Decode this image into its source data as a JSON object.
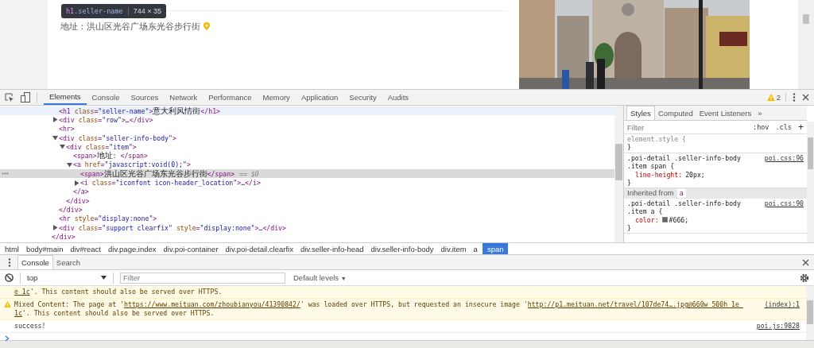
{
  "page": {
    "tooltip": {
      "tag": "h1",
      "class_name": ".seller-name",
      "size": "744 × 35"
    },
    "address": "地址：洪山区光谷广场东光谷步行街"
  },
  "devtools": {
    "tabs": [
      {
        "label": "Elements",
        "selected": true
      },
      {
        "label": "Console",
        "selected": false
      },
      {
        "label": "Sources",
        "selected": false
      },
      {
        "label": "Network",
        "selected": false
      },
      {
        "label": "Performance",
        "selected": false
      },
      {
        "label": "Memory",
        "selected": false
      },
      {
        "label": "Application",
        "selected": false
      },
      {
        "label": "Security",
        "selected": false
      },
      {
        "label": "Audits",
        "selected": false
      }
    ],
    "warning_count": "2"
  },
  "dom_tree": {
    "close": "</div>",
    "children": [
      {
        "open": "<h1 class=\"seller-name\">意大利风情街</h1>",
        "selected": false,
        "hovered": true
      },
      {
        "open": "<div class=\"row\">…</div>",
        "expanded": false,
        "selected": false,
        "hovered": false
      },
      {
        "open": "<hr>",
        "selected": false,
        "hovered": false
      },
      {
        "open": "<div class=\"seller-info-body\">",
        "expanded": true,
        "selected": false,
        "hovered": false,
        "close": "</div>",
        "children": [
          {
            "open": "<div class=\"item\">",
            "expanded": true,
            "selected": false,
            "hovered": false,
            "close": "</div>",
            "children": [
              {
                "open": "<span>地址: </span>",
                "selected": false,
                "hovered": false
              },
              {
                "open": "<a href=\"javascript:void(0);\">",
                "expanded": true,
                "selected": false,
                "hovered": false,
                "close": "</a>",
                "children": [
                  {
                    "open": "<span>洪山区光谷广场东光谷步行街</span>",
                    "suffix": "== $0",
                    "selected": true,
                    "hovered": false
                  },
                  {
                    "open": "<i class=\"iconfont icon-header_location\">…</i>",
                    "expanded": false,
                    "selected": false,
                    "hovered": false
                  }
                ]
              }
            ]
          }
        ]
      },
      {
        "open": "<hr style=\"display:none\">",
        "selected": false,
        "hovered": false
      },
      {
        "open": "<div class=\"support clearfix\" style=\"display:none\">…</div>",
        "expanded": false,
        "selected": false,
        "hovered": false
      }
    ]
  },
  "breadcrumbs": [
    {
      "label": "html",
      "selected": false
    },
    {
      "label": "body#main",
      "selected": false
    },
    {
      "label": "div#react",
      "selected": false
    },
    {
      "label": "div.page.index",
      "selected": false
    },
    {
      "label": "div.poi-container",
      "selected": false
    },
    {
      "label": "div.poi-detail.clearfix",
      "selected": false
    },
    {
      "label": "div.seller-info-head",
      "selected": false
    },
    {
      "label": "div.seller-info-body",
      "selected": false
    },
    {
      "label": "div.item",
      "selected": false
    },
    {
      "label": "a",
      "selected": false
    },
    {
      "label": "span",
      "selected": true
    }
  ],
  "styles": {
    "tabs": [
      {
        "label": "Styles",
        "selected": true
      },
      {
        "label": "Computed",
        "selected": false
      },
      {
        "label": "Event Listeners",
        "selected": false
      },
      {
        "label": "»",
        "selected": false
      }
    ],
    "filter_placeholder": "Filter",
    "hov": ":hov",
    "cls": ".cls",
    "add": "+",
    "rules": [
      {
        "kind": "rule",
        "muted": true,
        "selector": "element.style {",
        "close": "}"
      },
      {
        "kind": "rule",
        "muted": false,
        "selector": ".poi-detail .seller-info-body .item span {",
        "source": "poi.css:96",
        "declarations": [
          {
            "property": "line-height:",
            "value": "20px;"
          }
        ],
        "close": "}"
      },
      {
        "kind": "inherited",
        "label": "Inherited from",
        "element": "a"
      },
      {
        "kind": "rule",
        "muted": false,
        "selector": ".poi-detail .seller-info-body .item a {",
        "source": "poi.css:90",
        "declarations": [
          {
            "property": "color:",
            "swatch": true,
            "value": "#666;"
          }
        ],
        "close": "}"
      }
    ]
  },
  "console": {
    "tabs": [
      {
        "label": "Console",
        "selected": true
      },
      {
        "label": "Search",
        "selected": false
      }
    ],
    "context": "top",
    "filter_placeholder": "Filter",
    "levels": "Default levels",
    "levels_caret": "▼",
    "messages": [
      {
        "kind": "warning",
        "icon": false,
        "lines": [
          [
            {
              "text": "e_1c",
              "link": true
            },
            {
              "text": "'. This content should also be served over HTTPS.",
              "link": false
            }
          ]
        ]
      },
      {
        "kind": "warning",
        "icon": true,
        "source": "(index):1",
        "lines": [
          [
            {
              "text": "Mixed Content: The page at '",
              "link": false
            },
            {
              "text": "https://www.meituan.com/zhoubianyou/41390842/",
              "link": true
            },
            {
              "text": "' was loaded over HTTPS, but requested an insecure image '",
              "link": false
            },
            {
              "text": "http://p1.meituan.net/travel/107de74….jpg@660w_500h_1e_",
              "link": true
            }
          ],
          [
            {
              "text": "1c",
              "link": true
            },
            {
              "text": "'. This content should also be served over HTTPS.",
              "link": false
            }
          ]
        ]
      },
      {
        "kind": "log",
        "icon": false,
        "source": "poi.js:9828",
        "lines": [
          [
            {
              "text": "success!",
              "link": false
            }
          ]
        ]
      }
    ]
  }
}
